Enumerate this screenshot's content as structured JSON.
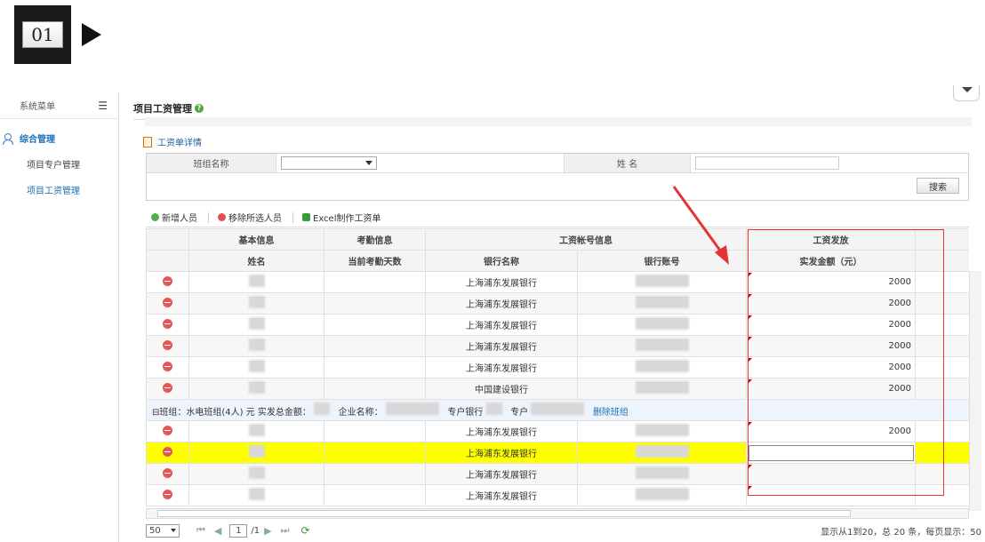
{
  "step": {
    "label": "01"
  },
  "sidebar": {
    "title": "系统菜单",
    "group": "综合管理",
    "items": [
      {
        "label": "项目专户管理"
      },
      {
        "label": "项目工资管理"
      }
    ]
  },
  "page": {
    "title": "项目工资管理",
    "help": "?"
  },
  "detail": {
    "header": "工资单详情"
  },
  "search": {
    "team_label": "班组名称",
    "name_label": "姓 名",
    "button": "搜索"
  },
  "toolbar": {
    "add": "新增人员",
    "remove": "移除所选人员",
    "excel": "Excel制作工资单"
  },
  "grid": {
    "groups": [
      "基本信息",
      "考勤信息",
      "工资帐号信息",
      "工资发放"
    ],
    "columns": [
      "姓名",
      "当前考勤天数",
      "银行名称",
      "银行账号",
      "实发金额（元）"
    ],
    "rows": [
      {
        "bank": "上海浦东发展银行",
        "amount": "2000"
      },
      {
        "bank": "上海浦东发展银行",
        "amount": "2000"
      },
      {
        "bank": "上海浦东发展银行",
        "amount": "2000"
      },
      {
        "bank": "上海浦东发展银行",
        "amount": "2000"
      },
      {
        "bank": "上海浦东发展银行",
        "amount": "2000"
      },
      {
        "bank": "中国建设银行",
        "amount": "2000"
      }
    ],
    "group_row": {
      "team": "⊟班组：水电班组(4人) 元",
      "total": "实发总金额：",
      "company": "企业名称：",
      "bank": "专户银行",
      "account": "专户",
      "delete": "删除班组"
    },
    "rows2": [
      {
        "bank": "上海浦东发展银行",
        "amount": "2000"
      },
      {
        "bank": "上海浦东发展银行",
        "amount": ""
      },
      {
        "bank": "上海浦东发展银行",
        "amount": ""
      },
      {
        "bank": "上海浦东发展银行",
        "amount": ""
      }
    ]
  },
  "pager": {
    "size": "50",
    "page": "1",
    "total_pages": "/1",
    "info": "显示从1到20，总 20 条，每页显示：50"
  },
  "colors": {
    "highlight": "#ffff00",
    "annotation": "#e33333",
    "link": "#1b6fb5"
  }
}
